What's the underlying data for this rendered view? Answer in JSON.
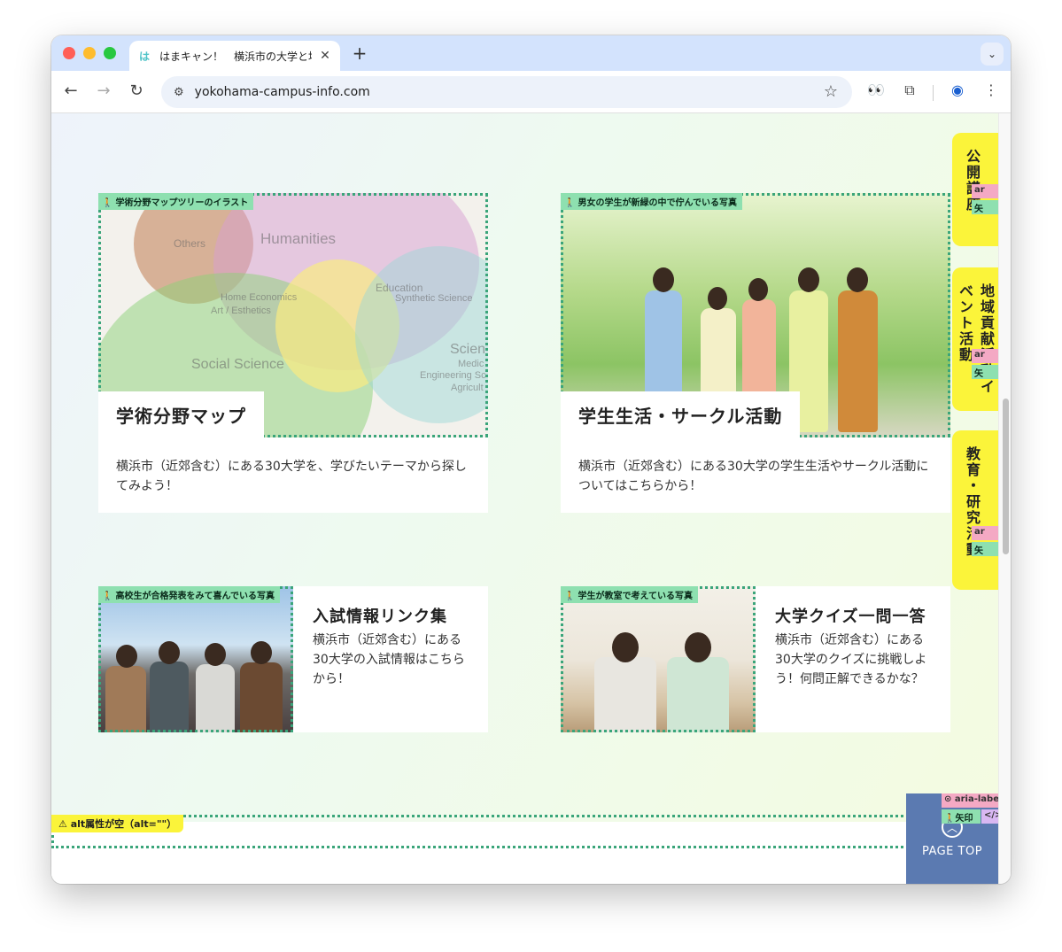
{
  "browser": {
    "tab_title": "はまキャン！　横浜市の大学と地",
    "favicon_char": "は",
    "url": "yokohama-campus-info.com"
  },
  "cards": [
    {
      "alt": "学術分野マップツリーのイラスト",
      "title": "学術分野マップ",
      "description": "横浜市（近郊含む）にある30大学を、学びたいテーマから探してみよう！"
    },
    {
      "alt": "男女の学生が新緑の中で佇んでいる写真",
      "title": "学生生活・サークル活動",
      "description": "横浜市（近郊含む）にある30大学の学生生活やサークル活動についてはこちらから！"
    },
    {
      "alt": "高校生が合格発表をみて喜んでいる写真",
      "title": "入試情報リンク集",
      "description": "横浜市（近郊含む）にある30大学の入試情報はこちらから！"
    },
    {
      "alt": "学生が教室で考えている写真",
      "title": "大学クイズ一問一答",
      "description": "横浜市（近郊含む）にある30大学のクイズに挑戦しよう！何問正解できるかな？"
    }
  ],
  "venn_labels": {
    "others": "Others",
    "humanities": "Humanities",
    "home_economics": "Home Economics",
    "art": "Art / Esthetics",
    "education": "Education",
    "synthetic": "Synthetic Science",
    "social": "Social Science",
    "science": "Scien",
    "medical": "Medic",
    "engineering": "Engineering Sc",
    "agri": "Agricult"
  },
  "side_tabs": [
    {
      "label": "公開講座"
    },
    {
      "label": "地域貢献活動イベント活動"
    },
    {
      "label": "教育・研究活動"
    }
  ],
  "aria": {
    "label_short": "ar",
    "label_long": "aria-labe",
    "arrow_short": "矢",
    "arrow_long": "矢印",
    "code": "</>",
    "alt_empty_warning": "alt属性が空（alt=\"\"）"
  },
  "page_top": {
    "label": "PAGE TOP"
  },
  "colors": {
    "accent_yellow": "#fbf43a",
    "a11y_green": "#8ee0b0",
    "pagetop_blue": "#5b7ab1"
  }
}
